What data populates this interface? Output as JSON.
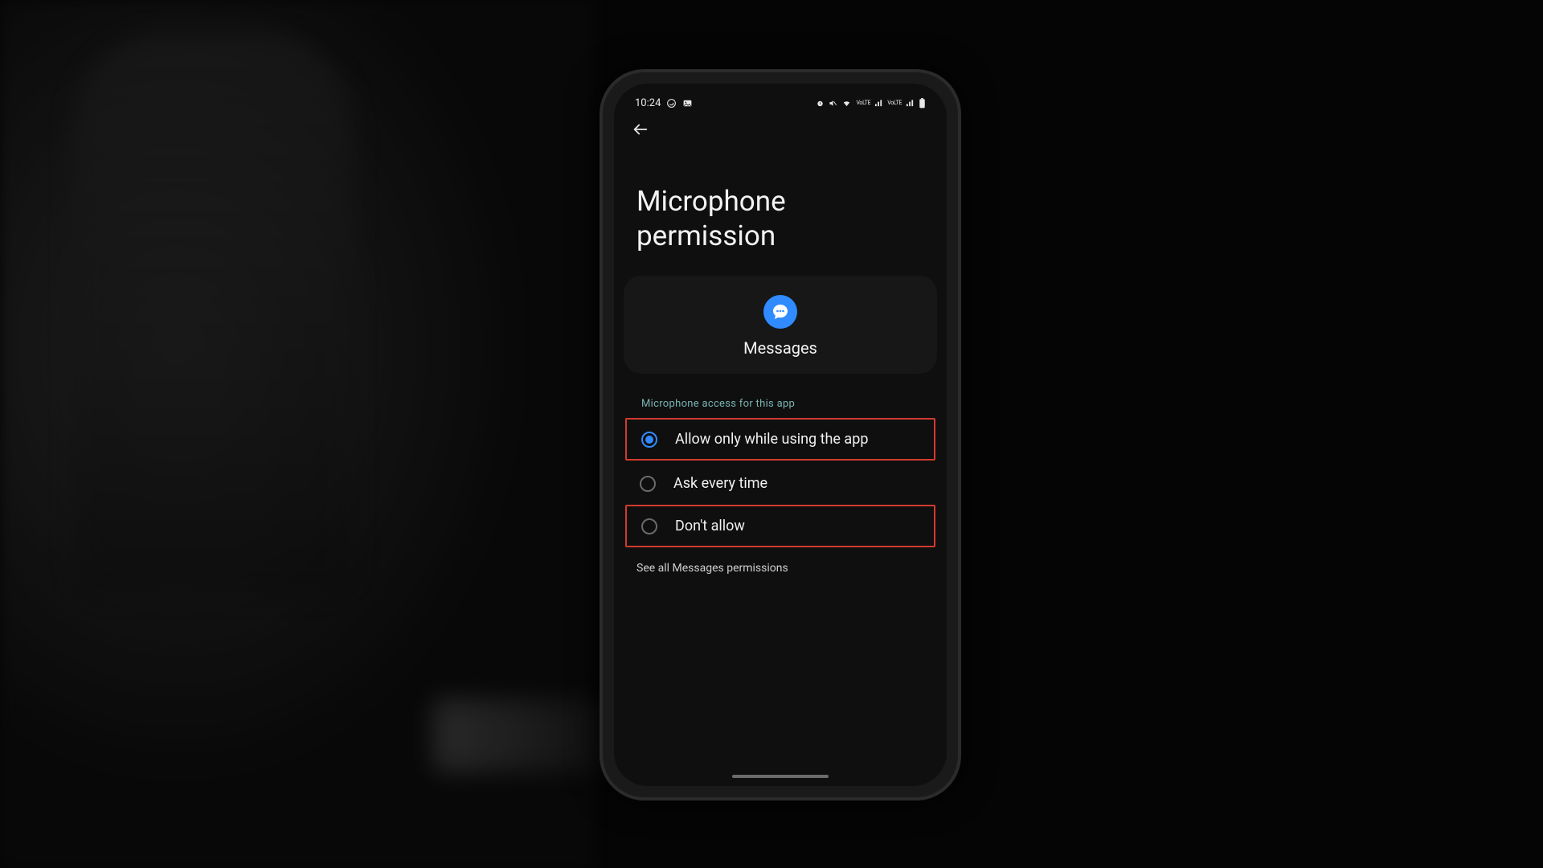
{
  "status_bar": {
    "time": "10:24"
  },
  "page": {
    "title_line1": "Microphone",
    "title_line2": "permission"
  },
  "app": {
    "name": "Messages"
  },
  "section": {
    "label": "Microphone access for this app"
  },
  "options": [
    {
      "label": "Allow only while using the app",
      "selected": true,
      "highlighted": true
    },
    {
      "label": "Ask every time",
      "selected": false,
      "highlighted": false
    },
    {
      "label": "Don't allow",
      "selected": false,
      "highlighted": true
    }
  ],
  "link": {
    "label": "See all Messages permissions"
  },
  "colors": {
    "accent": "#2f8bff",
    "highlight_border": "#d33a2f",
    "section_label": "#7bb3b3"
  }
}
